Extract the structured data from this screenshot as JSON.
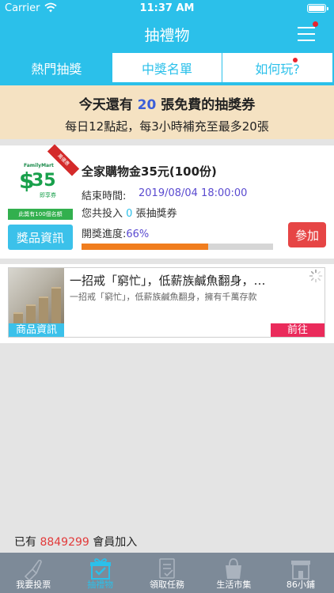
{
  "status_bar": {
    "carrier": "Carrier",
    "time": "11:37 AM"
  },
  "nav": {
    "title": "抽禮物"
  },
  "tabs": [
    {
      "label": "熱門抽獎",
      "active": true
    },
    {
      "label": "中獎名單",
      "active": false
    },
    {
      "label": "如何玩?",
      "active": false,
      "badge": true
    }
  ],
  "banner": {
    "line1_prefix": "今天還有",
    "free_count": "20",
    "line1_suffix": "張免費的抽獎券",
    "line2": "每日12點起，每3小時補充至最多20張"
  },
  "prize": {
    "coupon": {
      "brand": "FamilyMart",
      "currency": "$",
      "amount": "35",
      "subtitle": "即享券",
      "ribbon": "萬優惠",
      "tag": "此獎有100個名額"
    },
    "info_button": "獎品資訊",
    "title": "全家購物金35元(100份)",
    "end_label": "結束時間:",
    "end_value": "2019/08/04 18:00:00",
    "invest_prefix": "您共投入",
    "invest_count": "0",
    "invest_suffix": "張抽獎券",
    "progress_label": "開獎進度:",
    "progress_value": "66%",
    "progress_fraction": 0.66,
    "join_button": "參加"
  },
  "article": {
    "title": "一招戒「窮忙」，低薪族鹹魚翻身，…",
    "subtitle": "一招戒「窮忙」，低薪族鹹魚翻身，擁有千萬存款",
    "info_label": "商品資訊",
    "go_button": "前往"
  },
  "members": {
    "prefix": "已有",
    "count": "8849299",
    "suffix": "會員加入"
  },
  "tabbar": [
    {
      "label": "我要投票",
      "icon": "vote-icon",
      "active": false
    },
    {
      "label": "抽禮物",
      "icon": "gift-icon",
      "active": true
    },
    {
      "label": "領取任務",
      "icon": "task-icon",
      "active": false
    },
    {
      "label": "生活市集",
      "icon": "shopping-bag-icon",
      "active": false
    },
    {
      "label": "86小鋪",
      "icon": "store-icon",
      "active": false
    }
  ],
  "colors": {
    "primary": "#2bc0ea",
    "danger": "#e64545",
    "progress": "#f07d1e",
    "tabbar": "#7d8a98"
  }
}
